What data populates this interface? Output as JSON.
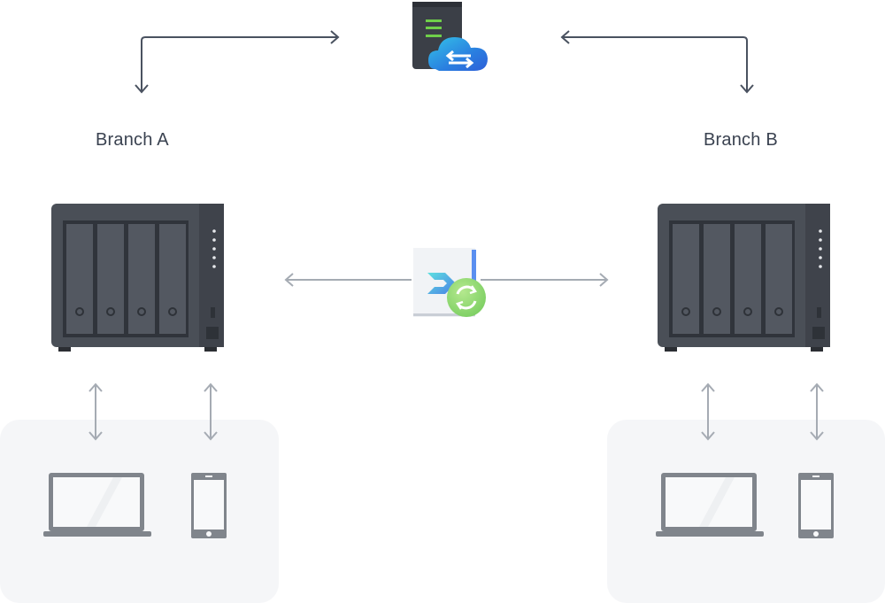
{
  "diagram": {
    "type": "network-topology",
    "central_service": {
      "name": "cloud-sync-server",
      "icon": "server-cloud-sync-icon"
    },
    "sync_app": {
      "name": "sync-app",
      "icon": "drive-sync-app-icon"
    },
    "branches": [
      {
        "id": "branch-a",
        "label": "Branch A",
        "nas_icon": "nas-4bay-icon",
        "devices": [
          {
            "icon": "laptop-icon"
          },
          {
            "icon": "smartphone-icon"
          }
        ]
      },
      {
        "id": "branch-b",
        "label": "Branch B",
        "nas_icon": "nas-4bay-icon",
        "devices": [
          {
            "icon": "laptop-icon"
          },
          {
            "icon": "smartphone-icon"
          }
        ]
      }
    ],
    "connections": [
      {
        "from": "cloud-sync-server",
        "to": "branch-a",
        "direction": "bidirectional"
      },
      {
        "from": "cloud-sync-server",
        "to": "branch-b",
        "direction": "bidirectional"
      },
      {
        "from": "branch-a",
        "to": "branch-b",
        "via": "sync-app",
        "direction": "bidirectional"
      },
      {
        "from": "branch-a",
        "to": "laptop",
        "direction": "bidirectional"
      },
      {
        "from": "branch-a",
        "to": "smartphone",
        "direction": "bidirectional"
      },
      {
        "from": "branch-b",
        "to": "laptop",
        "direction": "bidirectional"
      },
      {
        "from": "branch-b",
        "to": "smartphone",
        "direction": "bidirectional"
      }
    ],
    "colors": {
      "arrow_dark": "#4a5260",
      "arrow_light": "#a5abb3",
      "nas_body": "#4a4f57",
      "panel_bg": "#f5f6f8",
      "device_gray": "#80858c",
      "label_text": "#3a4250"
    }
  }
}
